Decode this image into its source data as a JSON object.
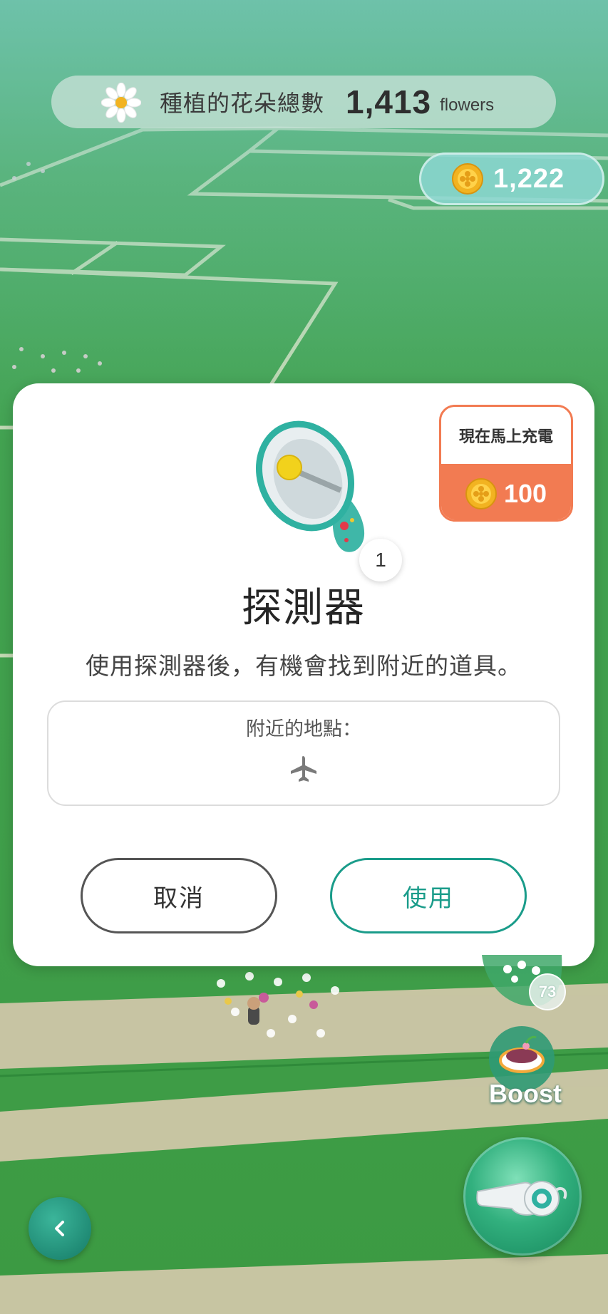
{
  "header": {
    "flower_label": "種植的花朵總數",
    "flower_count": "1,413",
    "flower_unit": "flowers",
    "coin_balance": "1,222"
  },
  "dialog": {
    "recharge_title": "現在馬上充電",
    "recharge_price": "100",
    "item_quantity": "1",
    "item_name": "探測器",
    "item_description": "使用探測器後，有機會找到附近的道具。",
    "nearby_label": "附近的地點：",
    "nearby_icon": "airplane-icon",
    "cancel_label": "取消",
    "use_label": "使用"
  },
  "controls": {
    "boost_label": "Boost",
    "bubble_count": "73"
  },
  "colors": {
    "accent_teal": "#1a9c8a",
    "recharge_orange": "#f27b52",
    "grass_green": "#3f9b47",
    "path_tan": "#cfc7a8"
  }
}
